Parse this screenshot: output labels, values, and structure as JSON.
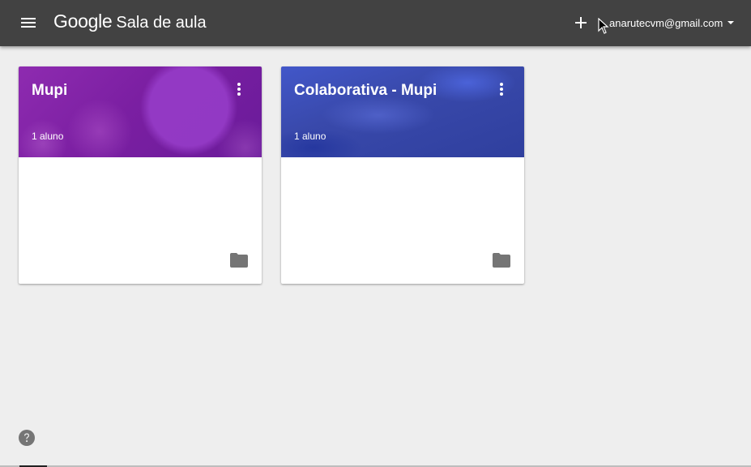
{
  "header": {
    "logo_google": "Google",
    "logo_product": "Sala de aula",
    "menu_icon": "hamburger-menu-icon",
    "add_icon": "plus-icon",
    "account_email": "anarutecvm@gmail.com",
    "background_color": "#424242"
  },
  "classes": [
    {
      "title": "Mupi",
      "students": "1 aluno",
      "theme_color": "#7b1fa2",
      "menu_icon": "more-vert-icon",
      "folder_icon": "folder-icon"
    },
    {
      "title": "Colaborativa - Mupi",
      "students": "1 aluno",
      "theme_color": "#3949ab",
      "menu_icon": "more-vert-icon",
      "folder_icon": "folder-icon"
    }
  ],
  "footer": {
    "help_icon": "help-circle-icon"
  },
  "colors": {
    "page_background": "#eeeeee",
    "icon_gray": "#757575"
  }
}
